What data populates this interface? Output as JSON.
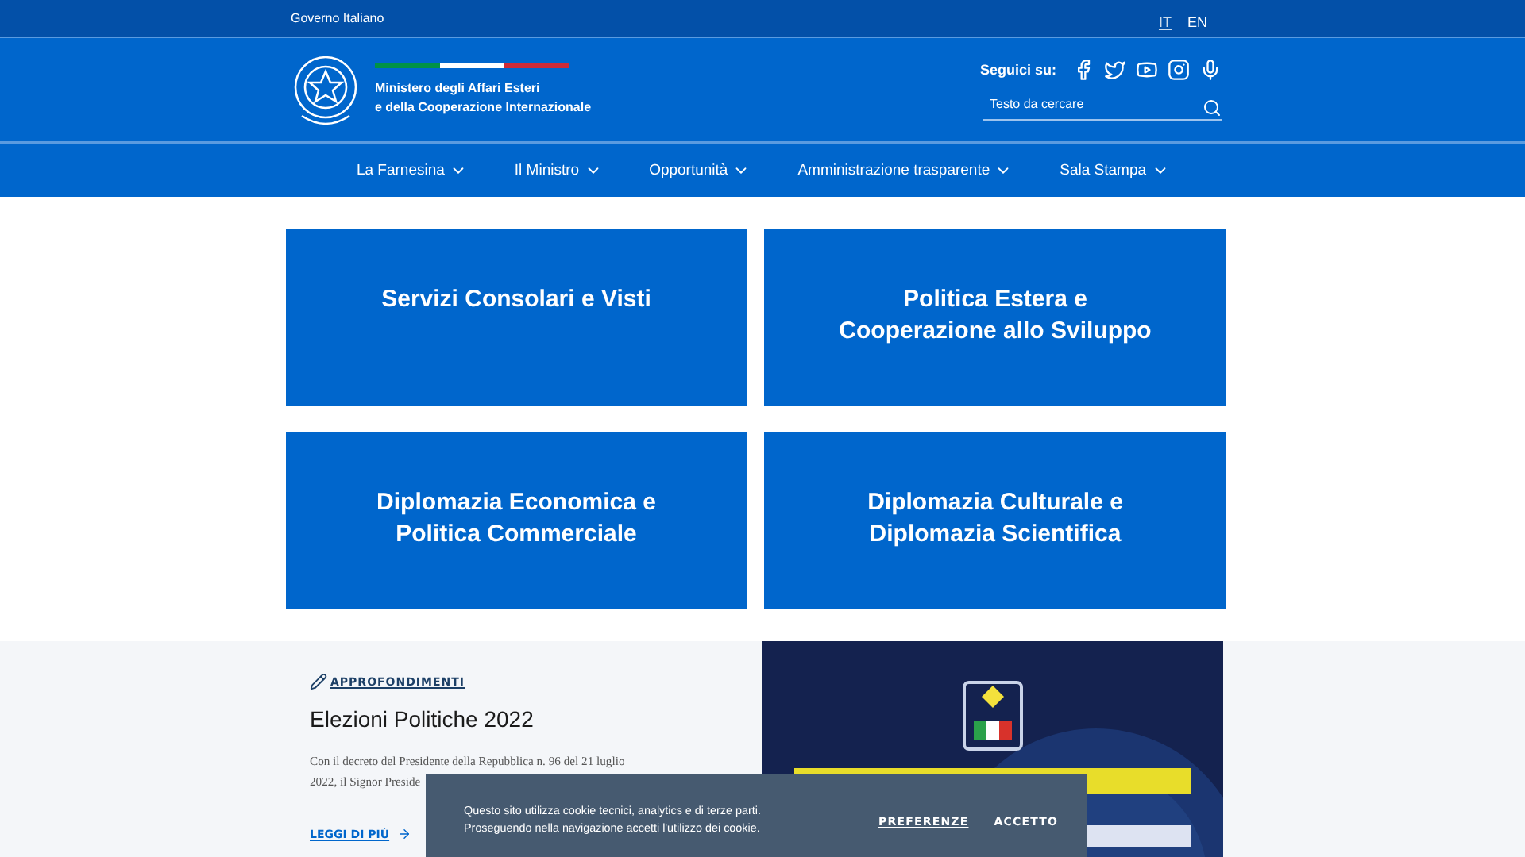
{
  "top_bar": {
    "label": "Governo Italiano",
    "languages": [
      {
        "label": "IT",
        "selected": true
      },
      {
        "label": "EN",
        "selected": false
      }
    ]
  },
  "header": {
    "title_lines": [
      "Ministero degli Affari Esteri",
      "e della Cooperazione Internazionale"
    ],
    "follow_label": "Seguici su:",
    "search": {
      "placeholder": "Testo da cercare"
    }
  },
  "nav": [
    {
      "label": "La Farnesina"
    },
    {
      "label": "Il Ministro"
    },
    {
      "label": "Opportunità"
    },
    {
      "label": "Amministrazione trasparente"
    },
    {
      "label": "Sala Stampa"
    }
  ],
  "tiles": [
    {
      "label": "Servizi Consolari e Visti"
    },
    {
      "label": "Politica Estera e Cooperazione allo Sviluppo"
    },
    {
      "label": "Diplomazia Economica e Politica Commerciale"
    },
    {
      "label": "Diplomazia Culturale e Diplomazia Scientifica"
    }
  ],
  "feature": {
    "category": "APPROFONDIMENTI",
    "title": "Elezioni Politiche 2022",
    "text": [
      "Con il decreto del Presidente della Repubblica n. 96 del 21 luglio",
      "2022, il Signor Preside"
    ],
    "link": "LEGGI DI PIÙ"
  },
  "cookie_banner": {
    "text": [
      "Questo sito utilizza cookie tecnici, analytics e di terze parti.",
      "Proseguendo nella navigazione accetti l'utilizzo dei cookie."
    ],
    "buttons": [
      {
        "label": "PREFERENZE",
        "kind": "link"
      },
      {
        "label": "ACCETTO",
        "kind": "primary"
      }
    ]
  }
}
